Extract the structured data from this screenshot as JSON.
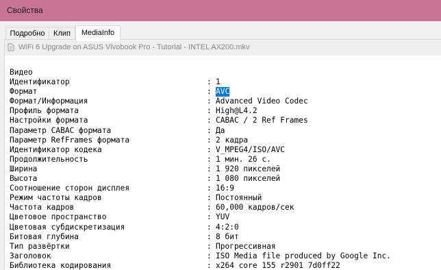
{
  "window": {
    "title": "Свойства"
  },
  "tabs": [
    {
      "label": "Подробно"
    },
    {
      "label": "Клип"
    },
    {
      "label": "MediaInfo"
    }
  ],
  "file": {
    "name": "WiFi 6 Upgrade on ASUS Vivobook Pro - Tutorial - INTEL AX200.mkv"
  },
  "info": {
    "section": "Видео",
    "separator": ":",
    "rows": [
      {
        "key": "Идентификатор",
        "value": "1"
      },
      {
        "key": "Формат",
        "value": "AVC",
        "selected": true
      },
      {
        "key": "Формат/Информация",
        "value": "Advanced Video Codec"
      },
      {
        "key": "Профиль формата",
        "value": "High@L4.2"
      },
      {
        "key": "Настройки формата",
        "value": "CABAC / 2 Ref Frames"
      },
      {
        "key": "Параметр CABAC формата",
        "value": "Да"
      },
      {
        "key": "Параметр RefFrames формата",
        "value": "2 кадра"
      },
      {
        "key": "Идентификатор кодека",
        "value": "V_MPEG4/ISO/AVC"
      },
      {
        "key": "Продолжительность",
        "value": "1 мин. 26 с."
      },
      {
        "key": "Ширина",
        "value": "1 920 пикселей"
      },
      {
        "key": "Высота",
        "value": "1 080 пикселей"
      },
      {
        "key": "Соотношение сторон дисплея",
        "value": "16:9"
      },
      {
        "key": "Режим частоты кадров",
        "value": "Постоянный"
      },
      {
        "key": "Частота кадров",
        "value": "60,000 кадров/сек"
      },
      {
        "key": "Цветовое пространство",
        "value": "YUV"
      },
      {
        "key": "Цветовая субдискретизация",
        "value": "4:2:0"
      },
      {
        "key": "Битовая глубина",
        "value": "8 бит"
      },
      {
        "key": "Тип развёртки",
        "value": "Прогрессивная"
      },
      {
        "key": "Заголовок",
        "value": "ISO Media file produced by Google Inc."
      },
      {
        "key": "Библиотека кодирования",
        "value": "x264 core 155 r2901 7d0ff22"
      }
    ]
  }
}
